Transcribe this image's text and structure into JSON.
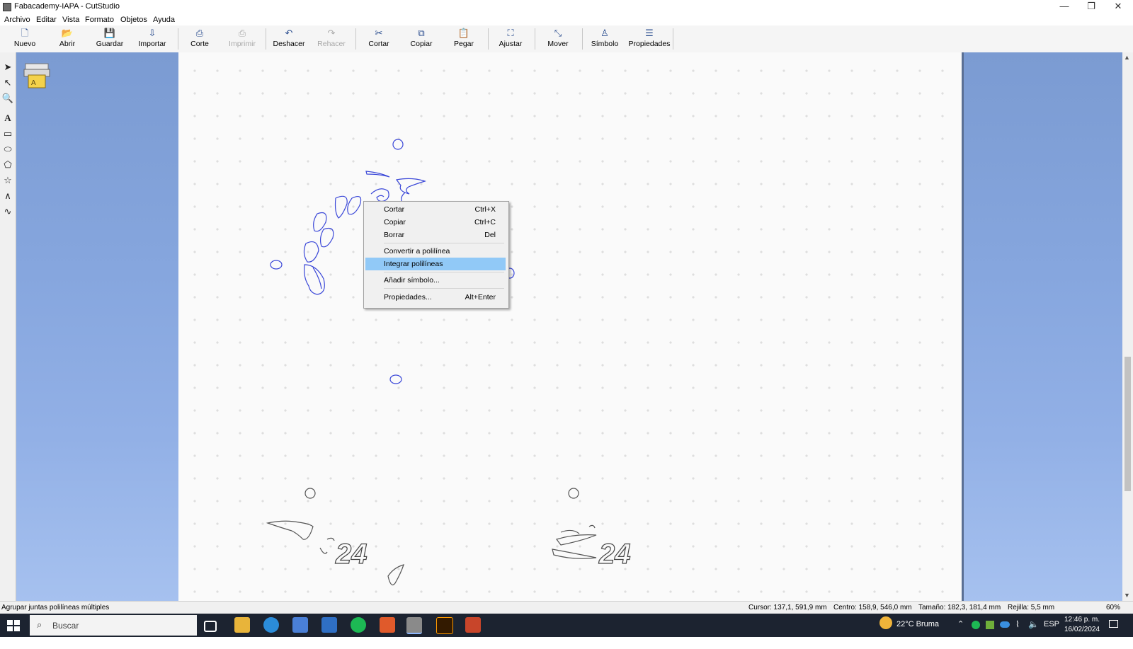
{
  "window": {
    "title": "Fabacademy-IAPA - CutStudio",
    "controls": {
      "minimize": "—",
      "restore": "❐",
      "close": "✕"
    }
  },
  "menu": [
    "Archivo",
    "Editar",
    "Vista",
    "Formato",
    "Objetos",
    "Ayuda"
  ],
  "toolbar": {
    "nuevo": "Nuevo",
    "abrir": "Abrir",
    "guardar": "Guardar",
    "importar": "Importar",
    "corte": "Corte",
    "imprimir": "Imprimir",
    "deshacer": "Deshacer",
    "rehacer": "Rehacer",
    "cortar": "Cortar",
    "copiar": "Copiar",
    "pegar": "Pegar",
    "ajustar": "Ajustar",
    "mover": "Mover",
    "simbolo": "Símbolo",
    "propiedades": "Propiedades"
  },
  "tools": [
    "select-arrow-icon",
    "node-edit-icon",
    "zoom-icon",
    "text-icon",
    "rectangle-icon",
    "ellipse-icon",
    "polygon-icon",
    "star-icon",
    "polyline-icon",
    "freehand-icon"
  ],
  "canvas": {
    "text_24_left": "24",
    "text_24_right": "24"
  },
  "context_menu": {
    "items": [
      {
        "label": "Cortar",
        "shortcut": "Ctrl+X"
      },
      {
        "label": "Copiar",
        "shortcut": "Ctrl+C"
      },
      {
        "label": "Borrar",
        "shortcut": "Del"
      },
      {
        "label": "Convertir a polilínea",
        "shortcut": ""
      },
      {
        "label": "Integrar polilíneas",
        "shortcut": ""
      },
      {
        "label": "Añadir símbolo...",
        "shortcut": ""
      },
      {
        "label": "Propiedades...",
        "shortcut": "Alt+Enter"
      }
    ],
    "highlighted": "Integrar polilíneas"
  },
  "status": {
    "hint": "Agrupar juntas polilíneas múltiples",
    "cursor": "Cursor: 137,1, 591,9 mm",
    "centro": "Centro: 158,9, 546,0 mm",
    "tamano": "Tamaño: 182,3, 181,4 mm",
    "rejilla": "Rejilla: 5,5 mm",
    "zoom": "60%"
  },
  "taskbar": {
    "search_placeholder": "Buscar",
    "weather": "22°C  Bruma",
    "language": "ESP",
    "time": "12:46 p. m.",
    "date": "16/02/2024"
  },
  "colors": {
    "selection_stroke": "#3a47d8",
    "menu_highlight": "#91c9f7",
    "background_blue": "#86a6de"
  }
}
